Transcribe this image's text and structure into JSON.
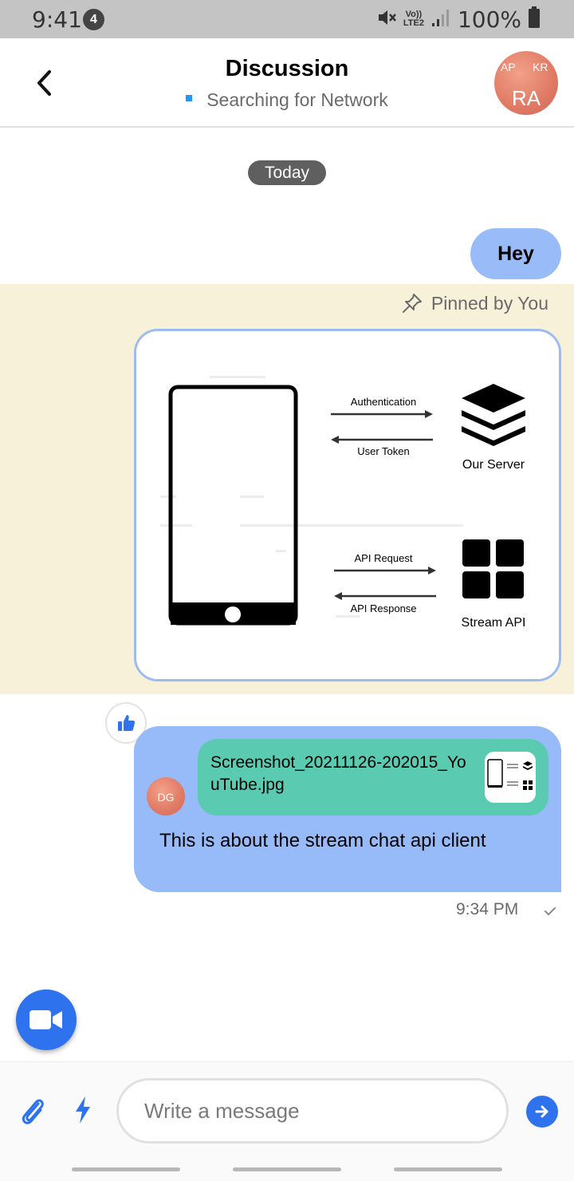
{
  "status_bar": {
    "time": "9:41",
    "notification_count": "4",
    "network_top": "Vo))",
    "network_bottom": "LTE2",
    "battery": "100%"
  },
  "header": {
    "title": "Discussion",
    "subtitle": "Searching for Network",
    "avatar": {
      "top_left": "AP",
      "top_right": "KR",
      "main": "RA"
    }
  },
  "chat": {
    "date_separator": "Today",
    "messages": [
      {
        "text": "Hey"
      }
    ],
    "pinned": {
      "label": "Pinned by You",
      "image": {
        "labels": {
          "authentication": "Authentication",
          "user_token": "User Token",
          "our_server": "Our Server",
          "api_request": "API Request",
          "api_response": "API Response",
          "stream_api": "Stream API"
        }
      }
    },
    "message": {
      "attachment_name": "Screenshot_20211126-202015_YouTube.jpg",
      "text": "This is about the stream chat api client",
      "sender_initials": "DG",
      "time": "9:34 PM",
      "reaction": "thumbs-up-icon"
    }
  },
  "composer": {
    "placeholder": "Write a message"
  },
  "colors": {
    "accent": "#2e72ee",
    "bubble": "#96bbf8",
    "pinned_bg": "#f8f1da",
    "attachment_bg": "#5acbb0"
  }
}
